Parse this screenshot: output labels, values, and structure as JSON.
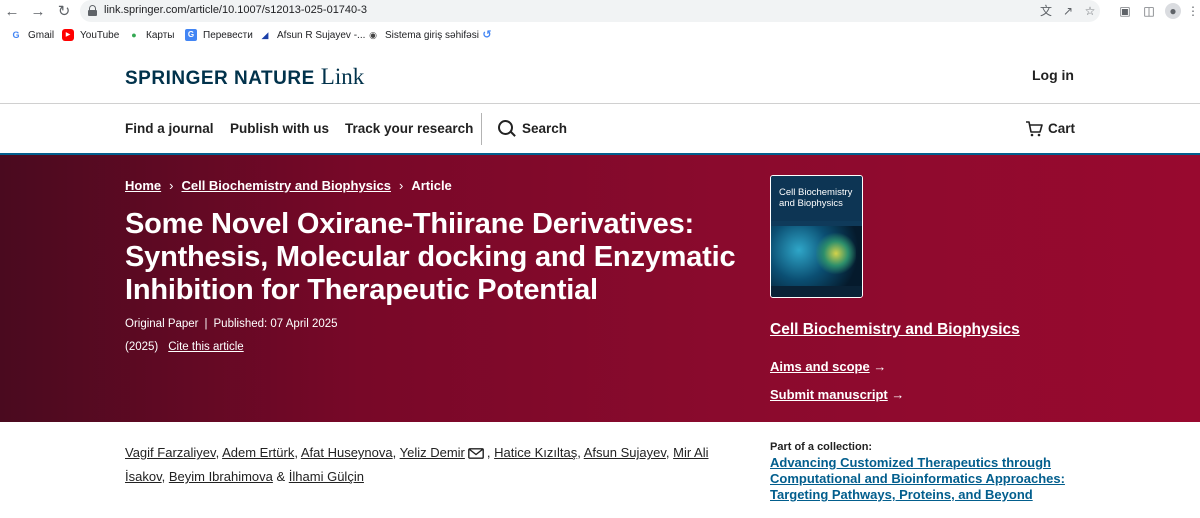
{
  "browser": {
    "url": "link.springer.com/article/10.1007/s12013-025-01740-3",
    "bookmarks": [
      {
        "label": "Gmail",
        "icon": "google-icon"
      },
      {
        "label": "YouTube",
        "icon": "youtube-icon"
      },
      {
        "label": "Карты",
        "icon": "maps-icon"
      },
      {
        "label": "Перевести",
        "icon": "translate-icon"
      },
      {
        "label": "Afsun R Sujayev -...",
        "icon": "site-icon"
      },
      {
        "label": "Sistema giriş səhifəsi",
        "icon": "globe-icon"
      }
    ]
  },
  "header": {
    "logo_brand": "SPRINGER NATURE",
    "logo_link": "Link",
    "login": "Log in"
  },
  "nav": {
    "find_journal": "Find a journal",
    "publish": "Publish with us",
    "track": "Track your research",
    "search": "Search",
    "cart": "Cart"
  },
  "breadcrumb": {
    "home": "Home",
    "journal": "Cell Biochemistry and Biophysics",
    "current": "Article"
  },
  "article": {
    "title": "Some Novel Oxirane-Thiirane Derivatives: Synthesis, Molecular docking and Enzymatic Inhibition for Therapeutic Potential",
    "type": "Original Paper",
    "published": "Published: 07 April 2025",
    "year": "(2025)",
    "cite": "Cite this article"
  },
  "journal": {
    "cover_title": "Cell Biochemistry and Biophysics",
    "name": "Cell Biochemistry and Biophysics",
    "aims": "Aims and scope",
    "submit": "Submit manuscript"
  },
  "authors": [
    "Vagif Farzaliyev",
    "Adem Ertürk",
    "Afat Huseynova",
    "Yeliz Demir",
    "Hatice Kızıltaş",
    "Afsun Sujayev",
    "Mir Ali İsakov",
    "Beyim Ibrahimova",
    "İlhami Gülçin"
  ],
  "collection": {
    "label": "Part of a collection:",
    "title": "Advancing Customized Therapeutics through Computational and Bioinformatics Approaches: Targeting Pathways, Proteins, and Beyond"
  },
  "colors": {
    "brand_navy": "#01324b",
    "hero_red": "#8a0a2d",
    "link_blue": "#025e8d"
  }
}
